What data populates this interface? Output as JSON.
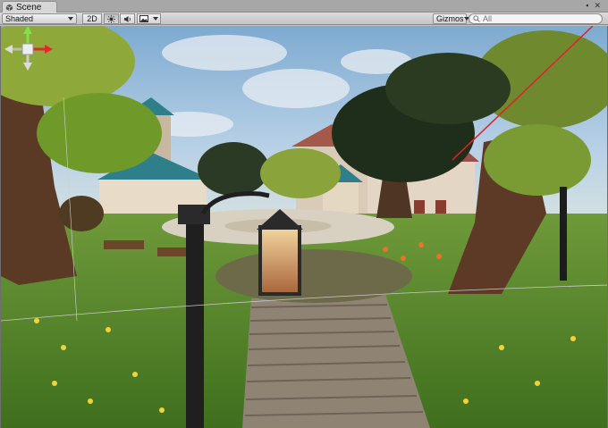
{
  "window": {
    "tab_label": "Scene",
    "tab_icon": "scene-icon"
  },
  "toolbar": {
    "draw_mode": "Shaded",
    "mode_2d": "2D",
    "lighting_icon": "sun-icon",
    "audio_icon": "speaker-icon",
    "effects_icon": "image-icon",
    "gizmos_label": "Gizmos",
    "search_placeholder": "All",
    "search_icon": "search-icon"
  },
  "scene_gizmo": {
    "axes": [
      "y",
      "x",
      "z"
    ],
    "colors": {
      "x": "#e2282b",
      "y": "#7ee24a",
      "z": "#3a6fe0"
    }
  },
  "colors": {
    "sky": "#9ec3df",
    "grass": "#5c8a2e",
    "path": "#8f8374",
    "selection_line": "#e0202a",
    "roof_teal": "#2f7f8a"
  }
}
